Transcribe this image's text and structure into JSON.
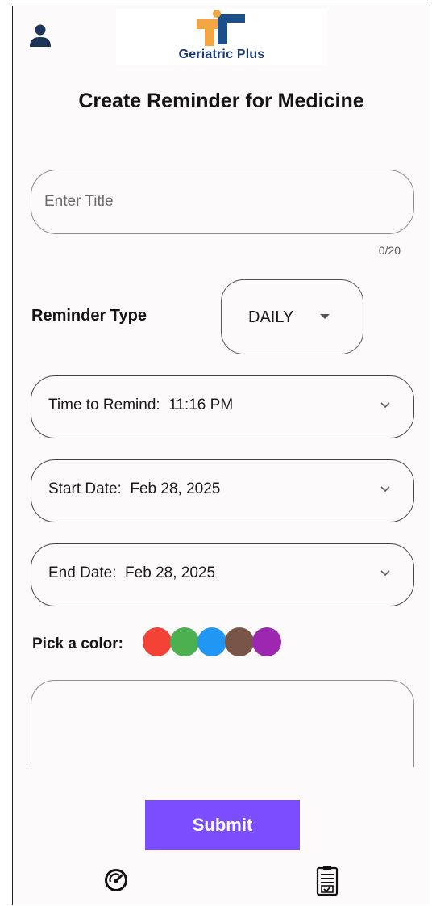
{
  "header": {
    "brand": "Geriatric Plus",
    "profile_icon": "person-icon"
  },
  "page": {
    "title": "Create Reminder for Medicine"
  },
  "form": {
    "title_placeholder": "Enter Title",
    "title_value": "",
    "char_counter": "0/20",
    "reminder_type_label": "Reminder Type",
    "reminder_type_value": "DAILY",
    "time_label": "Time to Remind:  11:16 PM",
    "start_date_label": "Start Date:  Feb 28, 2025",
    "end_date_label": "End Date:  Feb 28, 2025",
    "pick_color_label": "Pick a color:",
    "colors": [
      "#f44336",
      "#4caf50",
      "#2196f3",
      "#795548",
      "#9c27b0"
    ],
    "notes_value": "",
    "submit_label": "Submit"
  },
  "bottom_nav": {
    "items": [
      {
        "icon": "dashboard-gauge-icon"
      },
      {
        "icon": "clipboard-check-icon"
      }
    ]
  }
}
